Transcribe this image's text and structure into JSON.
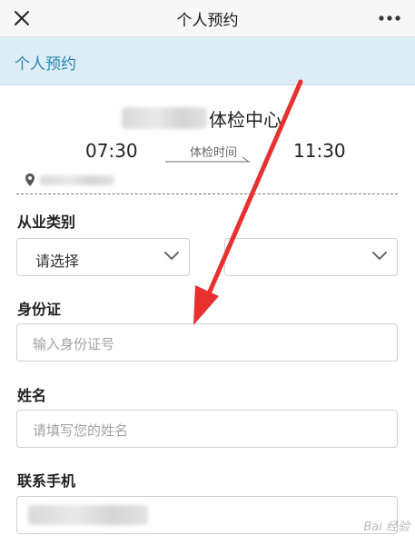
{
  "nav": {
    "title": "个人预约",
    "close_icon": "close-icon",
    "more_icon": "more-dots-icon"
  },
  "section": {
    "title": "个人预约"
  },
  "center": {
    "name_suffix": "体检中心",
    "start_time": "07:30",
    "time_label": "体检时间",
    "end_time": "11:30",
    "location_icon": "location-pin-icon"
  },
  "form": {
    "occupation": {
      "label": "从业类别",
      "select1_value": "请选择",
      "select2_value": ""
    },
    "id_card": {
      "label": "身份证",
      "placeholder": "输入身份证号"
    },
    "name": {
      "label": "姓名",
      "placeholder": "请填写您的姓名"
    },
    "phone": {
      "label": "联系手机"
    }
  },
  "watermark": {
    "text": "Bai 经验"
  },
  "colors": {
    "header_bg": "#dcedf5",
    "header_text": "#2a85b3",
    "annotation_arrow": "#e8302f"
  }
}
